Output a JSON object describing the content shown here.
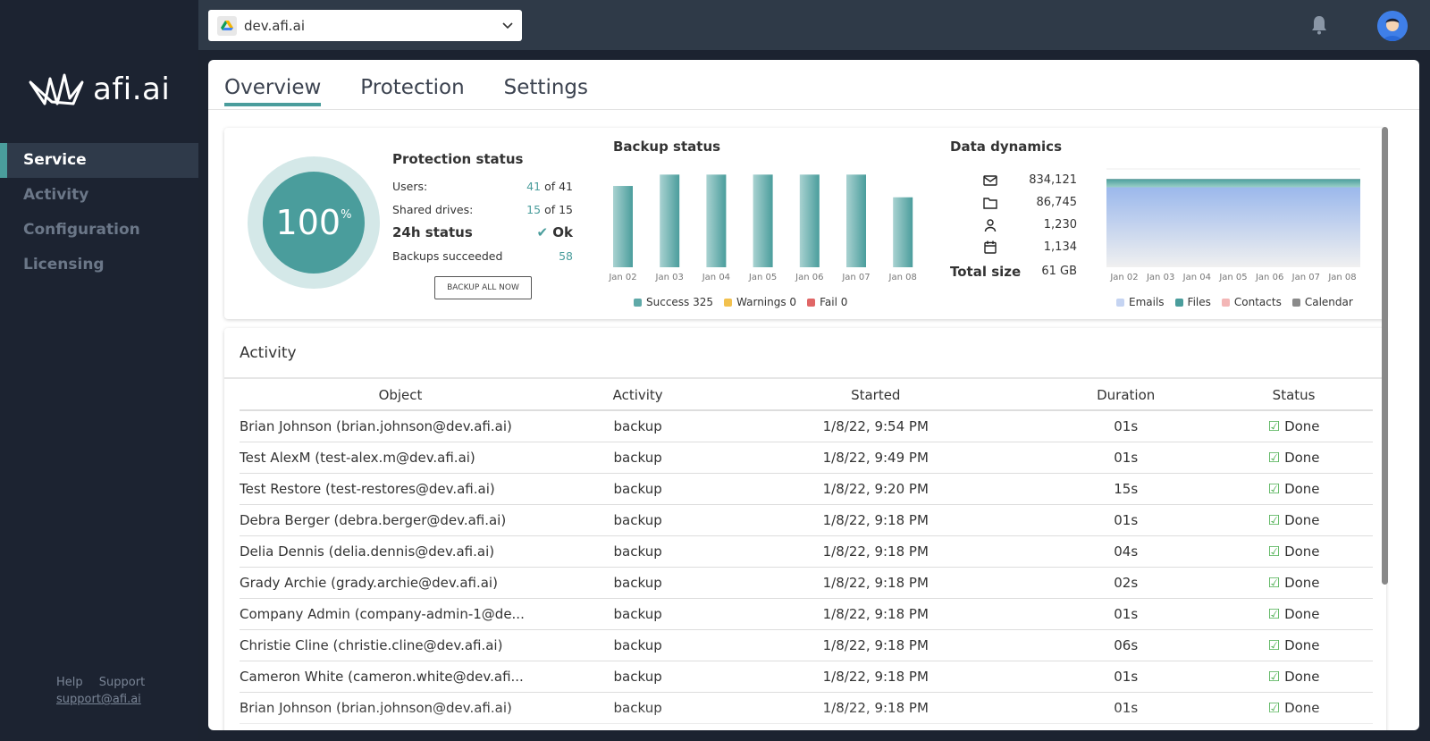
{
  "sidebar": {
    "logo": "afi.ai",
    "items": [
      {
        "label": "Service",
        "active": true
      },
      {
        "label": "Activity",
        "active": false
      },
      {
        "label": "Configuration",
        "active": false
      },
      {
        "label": "Licensing",
        "active": false
      }
    ],
    "footer": {
      "help": "Help",
      "support": "Support",
      "email": "support@afi.ai"
    }
  },
  "topbar": {
    "tenant": "dev.afi.ai",
    "icons": {
      "tenant": "google-drive-icon",
      "notifications": "bell-icon",
      "user": "avatar"
    }
  },
  "tabs": [
    {
      "label": "Overview",
      "active": true
    },
    {
      "label": "Protection",
      "active": false
    },
    {
      "label": "Settings",
      "active": false
    }
  ],
  "protection": {
    "percent": "100",
    "percent_sign": "%",
    "title": "Protection status",
    "users_label": "Users:",
    "users_value": "41",
    "users_total": "of 41",
    "drives_label": "Shared drives:",
    "drives_value": "15",
    "drives_total": "of 15",
    "status_label": "24h status",
    "status_value": "Ok",
    "succeeded_label": "Backups succeeded",
    "succeeded_value": "58",
    "backup_button": "BACKUP ALL NOW"
  },
  "colors": {
    "accent": "#4a9d9c",
    "success": "#5fa9a8",
    "warning": "#f2c14e",
    "fail": "#e06666",
    "emails": "#a9c1ec",
    "files": "#4a9d9c",
    "contacts": "#f3b6b6",
    "calendar": "#8a8a8a"
  },
  "chart_data": [
    {
      "type": "bar",
      "title": "Backup status",
      "categories": [
        "Jan 02",
        "Jan 03",
        "Jan 04",
        "Jan 05",
        "Jan 06",
        "Jan 07",
        "Jan 08"
      ],
      "series": [
        {
          "name": "Success",
          "values": [
            43,
            49,
            49,
            49,
            49,
            49,
            37
          ]
        },
        {
          "name": "Warnings",
          "values": [
            0,
            0,
            0,
            0,
            0,
            0,
            0
          ]
        },
        {
          "name": "Fail",
          "values": [
            0,
            0,
            0,
            0,
            0,
            0,
            0
          ]
        }
      ],
      "legend": [
        {
          "label": "Success 325",
          "color": "#5fa9a8"
        },
        {
          "label": "Warnings 0",
          "color": "#f2c14e"
        },
        {
          "label": "Fail 0",
          "color": "#e06666"
        }
      ],
      "ylim": [
        0,
        52
      ],
      "legend_position": "bottom"
    },
    {
      "type": "area",
      "title": "Data dynamics",
      "categories": [
        "Jan 02",
        "Jan 03",
        "Jan 04",
        "Jan 05",
        "Jan 06",
        "Jan 07",
        "Jan 08"
      ],
      "series": [
        {
          "name": "Emails",
          "values": [
            834121,
            834121,
            834121,
            834121,
            834121,
            834121,
            834121
          ]
        },
        {
          "name": "Files",
          "values": [
            86745,
            86745,
            86745,
            86745,
            86745,
            86745,
            86745
          ]
        },
        {
          "name": "Contacts",
          "values": [
            1230,
            1230,
            1230,
            1230,
            1230,
            1230,
            1230
          ]
        },
        {
          "name": "Calendar",
          "values": [
            1134,
            1134,
            1134,
            1134,
            1134,
            1134,
            1134
          ]
        }
      ],
      "legend": [
        {
          "label": "Emails",
          "color": "#c5d4f2"
        },
        {
          "label": "Files",
          "color": "#4a9d9c"
        },
        {
          "label": "Contacts",
          "color": "#f3b6b6"
        },
        {
          "label": "Calendar",
          "color": "#8a8a8a"
        }
      ],
      "stacked": true,
      "legend_position": "bottom"
    }
  ],
  "dynamics": {
    "rows": [
      {
        "icon": "mail-icon",
        "value": "834,121"
      },
      {
        "icon": "folder-icon",
        "value": "86,745"
      },
      {
        "icon": "contact-icon",
        "value": "1,230"
      },
      {
        "icon": "calendar-icon",
        "value": "1,134"
      }
    ],
    "total_label": "Total size",
    "total_value": "61 GB"
  },
  "activity": {
    "title": "Activity",
    "columns": [
      "Object",
      "Activity",
      "Started",
      "Duration",
      "Status"
    ],
    "rows": [
      [
        "Brian Johnson (brian.johnson@dev.afi.ai)",
        "backup",
        "1/8/22, 9:54 PM",
        "01s",
        "Done"
      ],
      [
        "Test AlexM (test-alex.m@dev.afi.ai)",
        "backup",
        "1/8/22, 9:49 PM",
        "01s",
        "Done"
      ],
      [
        "Test Restore (test-restores@dev.afi.ai)",
        "backup",
        "1/8/22, 9:20 PM",
        "15s",
        "Done"
      ],
      [
        "Debra Berger (debra.berger@dev.afi.ai)",
        "backup",
        "1/8/22, 9:18 PM",
        "01s",
        "Done"
      ],
      [
        "Delia Dennis (delia.dennis@dev.afi.ai)",
        "backup",
        "1/8/22, 9:18 PM",
        "04s",
        "Done"
      ],
      [
        "Grady Archie (grady.archie@dev.afi.ai)",
        "backup",
        "1/8/22, 9:18 PM",
        "02s",
        "Done"
      ],
      [
        "Company Admin (company-admin-1@de...",
        "backup",
        "1/8/22, 9:18 PM",
        "01s",
        "Done"
      ],
      [
        "Christie Cline (christie.cline@dev.afi.ai)",
        "backup",
        "1/8/22, 9:18 PM",
        "06s",
        "Done"
      ],
      [
        "Cameron White (cameron.white@dev.afi...",
        "backup",
        "1/8/22, 9:18 PM",
        "01s",
        "Done"
      ],
      [
        "Brian Johnson (brian.johnson@dev.afi.ai)",
        "backup",
        "1/8/22, 9:18 PM",
        "01s",
        "Done"
      ]
    ]
  }
}
